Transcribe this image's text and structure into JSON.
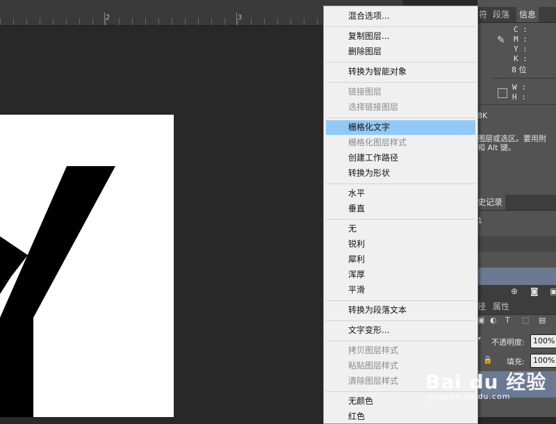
{
  "ruler": {
    "marks": [
      "2",
      "3"
    ]
  },
  "panel": {
    "tabs_top": [
      "符",
      "段落",
      "信息"
    ],
    "info_labels": [
      "C :",
      "M :",
      "Y :",
      "K :"
    ],
    "bit_depth": "8 位",
    "size_labels": [
      "W :",
      "H :"
    ],
    "mode_text": "8K",
    "hint_line1": "图层或选区。要用附",
    "hint_line2": "和 Alt 键。",
    "history_tab": "史记录",
    "history_item": "1",
    "layers_tabs": [
      "径",
      "属性"
    ],
    "opacity_label": "不透明度:",
    "opacity_value": "100%",
    "fill_label": "填充:",
    "fill_value": "100%"
  },
  "menu": {
    "items": [
      {
        "label": "混合选项...",
        "disabled": false
      },
      {
        "label": "复制图层...",
        "disabled": false
      },
      {
        "label": "删除图层",
        "disabled": false
      },
      {
        "label": "转换为智能对象",
        "disabled": false
      },
      {
        "label": "链接图层",
        "disabled": true
      },
      {
        "label": "选择链接图层",
        "disabled": true
      },
      {
        "label": "栅格化文字",
        "disabled": false,
        "highlighted": true
      },
      {
        "label": "栅格化图层样式",
        "disabled": true
      },
      {
        "label": "创建工作路径",
        "disabled": false
      },
      {
        "label": "转换为形状",
        "disabled": false
      },
      {
        "label": "水平",
        "disabled": false
      },
      {
        "label": "垂直",
        "disabled": false
      },
      {
        "label": "无",
        "disabled": false
      },
      {
        "label": "锐利",
        "disabled": false
      },
      {
        "label": "犀利",
        "disabled": false
      },
      {
        "label": "浑厚",
        "disabled": false
      },
      {
        "label": "平滑",
        "disabled": false
      },
      {
        "label": "转换为段落文本",
        "disabled": false
      },
      {
        "label": "文字变形...",
        "disabled": false
      },
      {
        "label": "拷贝图层样式",
        "disabled": true
      },
      {
        "label": "粘贴图层样式",
        "disabled": true
      },
      {
        "label": "清除图层样式",
        "disabled": true
      },
      {
        "label": "无颜色",
        "disabled": false
      },
      {
        "label": "红色",
        "disabled": false
      }
    ]
  },
  "watermark": {
    "brand": "Bai du 经验",
    "sub": "jingyan.baidu.com"
  }
}
